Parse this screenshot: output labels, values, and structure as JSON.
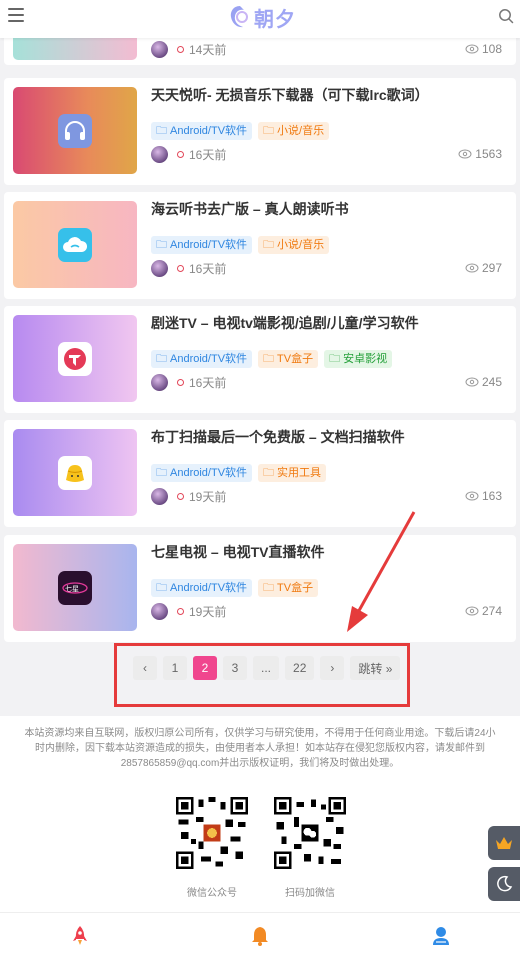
{
  "header": {
    "logo_text": "朝夕",
    "menu_icon": "menu-icon",
    "search_icon": "search-icon"
  },
  "first_item": {
    "time": "14天前",
    "views": "108"
  },
  "items": [
    {
      "title": "天天悦听- 无损音乐下载器（可下载lrc歌词）",
      "tags": [
        {
          "label": "Android/TV软件",
          "color": "blue"
        },
        {
          "label": "小说/音乐",
          "color": "orange"
        }
      ],
      "time": "16天前",
      "views": "1563",
      "icon": "headphones-icon"
    },
    {
      "title": "海云听书去广版 – 真人朗读听书",
      "tags": [
        {
          "label": "Android/TV软件",
          "color": "blue"
        },
        {
          "label": "小说/音乐",
          "color": "orange"
        }
      ],
      "time": "16天前",
      "views": "297",
      "icon": "cloud-icon"
    },
    {
      "title": "剧迷TV – 电视tv端影视/追剧/儿童/学习软件",
      "tags": [
        {
          "label": "Android/TV软件",
          "color": "blue"
        },
        {
          "label": "TV盒子",
          "color": "orange"
        },
        {
          "label": "安卓影视",
          "color": "green"
        }
      ],
      "time": "16天前",
      "views": "245",
      "icon": "tv-logo-icon"
    },
    {
      "title": "布丁扫描最后一个免费版 – 文档扫描软件",
      "tags": [
        {
          "label": "Android/TV软件",
          "color": "blue"
        },
        {
          "label": "实用工具",
          "color": "orange"
        }
      ],
      "time": "19天前",
      "views": "163",
      "icon": "pudding-icon"
    },
    {
      "title": "七星电视 – 电视TV直播软件",
      "tags": [
        {
          "label": "Android/TV软件",
          "color": "blue"
        },
        {
          "label": "TV盒子",
          "color": "orange"
        }
      ],
      "time": "19天前",
      "views": "274",
      "icon": "qixing-tv-icon"
    }
  ],
  "pagination": {
    "prev": "‹",
    "pages": [
      "1",
      "2",
      "3",
      "...",
      "22"
    ],
    "active": "2",
    "next": "›",
    "jump": "跳转 »"
  },
  "footer": {
    "notice": "本站资源均来自互联网，版权归原公司所有，仅供学习与研究使用，不得用于任何商业用途。下载后请24小时内删除，因下载本站资源造成的损失，由使用者本人承担！如本站存在侵犯您版权内容，请发邮件到2857865859@qq.com并出示版权证明，我们将及时做出处理。",
    "qr1_label": "微信公众号",
    "qr2_label": "扫码加微信"
  },
  "colors": {
    "accent": "#f0468e",
    "highlight": "#e53b3b",
    "tag_blue": "#2f86e0",
    "tag_orange": "#f07a10",
    "tag_green": "#25a03a"
  }
}
